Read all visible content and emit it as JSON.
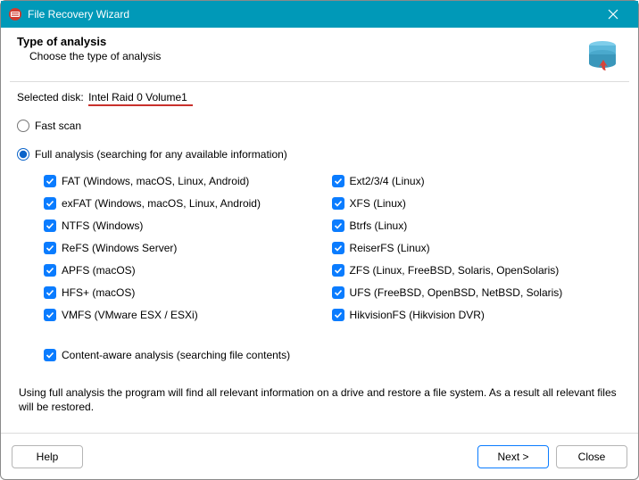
{
  "window": {
    "title": "File Recovery Wizard"
  },
  "header": {
    "title": "Type of analysis",
    "subtitle": "Choose the type of analysis"
  },
  "disk": {
    "label": "Selected disk:",
    "value": "Intel Raid 0 Volume1"
  },
  "scan": {
    "fast_label": "Fast scan",
    "full_label": "Full analysis (searching for any available information)",
    "content_aware_label": "Content-aware analysis (searching file contents)",
    "selected": "full",
    "filesystems_left": [
      "FAT (Windows, macOS, Linux, Android)",
      "exFAT (Windows, macOS, Linux, Android)",
      "NTFS (Windows)",
      "ReFS (Windows Server)",
      "APFS (macOS)",
      "HFS+ (macOS)",
      "VMFS (VMware ESX / ESXi)"
    ],
    "filesystems_right": [
      "Ext2/3/4 (Linux)",
      "XFS (Linux)",
      "Btrfs (Linux)",
      "ReiserFS (Linux)",
      "ZFS (Linux, FreeBSD, Solaris, OpenSolaris)",
      "UFS (FreeBSD, OpenBSD, NetBSD, Solaris)",
      "HikvisionFS (Hikvision DVR)"
    ]
  },
  "description": "Using full analysis the program will find all relevant information on a drive and restore a file system. As a result all relevant files will be restored.",
  "footer": {
    "help": "Help",
    "next": "Next >",
    "close": "Close"
  }
}
